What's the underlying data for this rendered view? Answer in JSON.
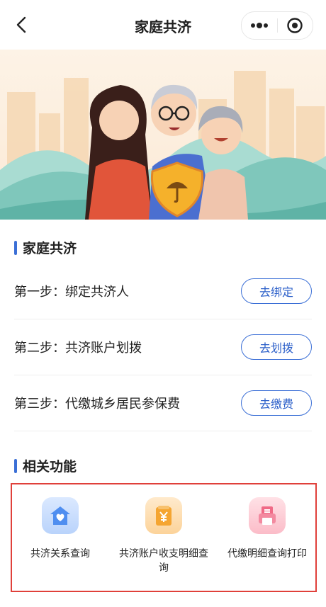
{
  "header": {
    "title": "家庭共济"
  },
  "section_family": {
    "title": "家庭共济"
  },
  "steps": [
    {
      "text": "第一步：绑定共济人",
      "button": "去绑定"
    },
    {
      "text": "第二步：共济账户划拨",
      "button": "去划拨"
    },
    {
      "text": "第三步：代缴城乡居民参保费",
      "button": "去缴费"
    }
  ],
  "section_related": {
    "title": "相关功能"
  },
  "functions": [
    {
      "label": "共济关系查询",
      "icon": "family-house-icon"
    },
    {
      "label": "共济账户收支明细查询",
      "icon": "wallet-yuan-icon"
    },
    {
      "label": "代缴明细查询打印",
      "icon": "printer-icon"
    }
  ],
  "colors": {
    "accent": "#3b6fd6",
    "highlight_border": "#e0403a"
  }
}
